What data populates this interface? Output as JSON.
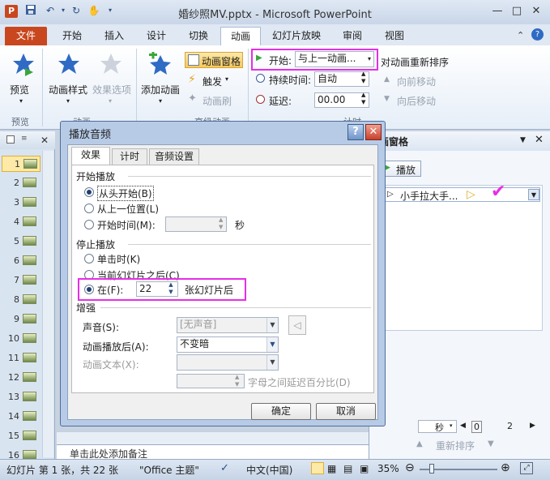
{
  "window": {
    "title": "婚纱照MV.pptx - Microsoft PowerPoint",
    "app_icon": "P",
    "minimize": "—",
    "restore": "□",
    "close": "✕",
    "help": "?",
    "ribbon_min": "⌃"
  },
  "tabs": [
    "文件",
    "开始",
    "插入",
    "设计",
    "切换",
    "动画",
    "幻灯片放映",
    "审阅",
    "视图"
  ],
  "ribbon": {
    "preview": "预览",
    "preview_group": "预览",
    "anim_style": "动画样式",
    "effect_options": "效果选项",
    "anim_group": "动画",
    "add_anim": "添加动画",
    "anim_pane_btn": "动画窗格",
    "trigger": "触发",
    "anim_painter": "动画刷",
    "adv_group": "高级动画",
    "start_label": "开始:",
    "start_value": "与上一动画...",
    "duration_label": "持续时间:",
    "duration_value": "自动",
    "delay_label": "延迟:",
    "delay_value": "00.00",
    "timing_group": "计时",
    "reorder": "对动画重新排序",
    "move_earlier": "向前移动",
    "move_later": "向后移动"
  },
  "thumbs": [
    "1",
    "2",
    "3",
    "4",
    "5",
    "6",
    "7",
    "8",
    "9",
    "10",
    "11",
    "12",
    "13",
    "14",
    "15",
    "16"
  ],
  "anim_pane": {
    "title": "画窗格",
    "play": "播放",
    "item_num": "0",
    "item_label": "小手拉大手...",
    "unit": "秒",
    "page": "0",
    "page2": "2",
    "reorder": "重新排序"
  },
  "notes_text": "单击此处添加备注",
  "status": {
    "slide": "幻灯片 第 1 张，共 22 张",
    "theme": "\"Office 主题\"",
    "lang": "中文(中国)",
    "zoom": "35%"
  },
  "dialog": {
    "title": "播放音频",
    "tabs": [
      "效果",
      "计时",
      "音频设置"
    ],
    "start_section": "开始播放",
    "start_opt1": "从头开始(B)",
    "start_opt2": "从上一位置(L)",
    "start_opt3": "开始时间(M):",
    "seconds": "秒",
    "stop_section": "停止播放",
    "stop_opt1": "单击时(K)",
    "stop_opt2": "当前幻灯片之后(C)",
    "stop_opt3": "在(F):",
    "stop_after_value": "22",
    "stop_after_suffix": "张幻灯片后",
    "enhance_section": "增强",
    "sound_label": "声音(S):",
    "sound_value": "[无声音]",
    "after_anim_label": "动画播放后(A):",
    "after_anim_value": "不变暗",
    "anim_text_label": "动画文本(X):",
    "letter_delay": "字母之间延迟百分比(D)",
    "ok": "确定",
    "cancel": "取消"
  },
  "colors": {
    "highlight": "#e62ee6",
    "file_tab": "#c9471f",
    "accent": "#2b4f86"
  }
}
